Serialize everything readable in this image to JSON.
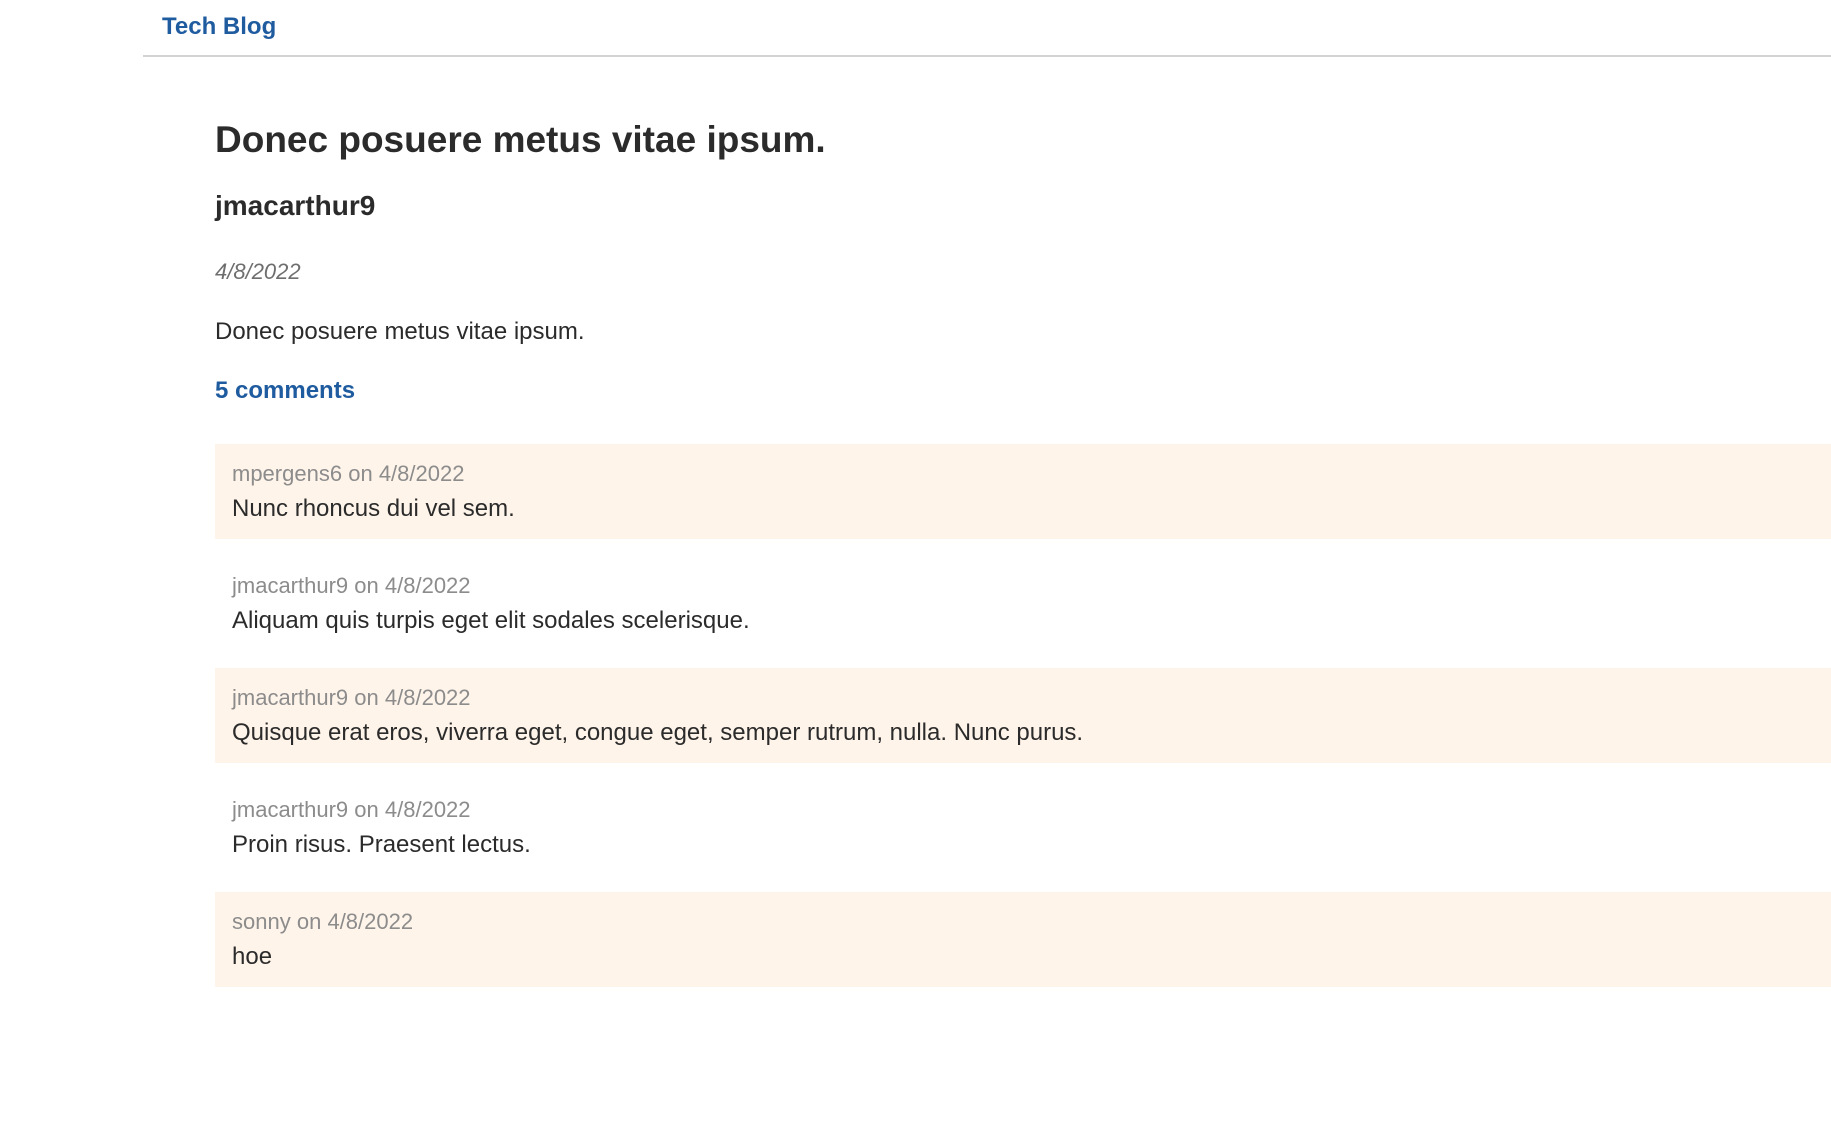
{
  "navbar": {
    "brand": "Tech Blog"
  },
  "post": {
    "title": "Donec posuere metus vitae ipsum.",
    "author": "jmacarthur9",
    "date": "4/8/2022",
    "body": "Donec posuere metus vitae ipsum.",
    "comment_count_label": "5 comments"
  },
  "comments": [
    {
      "author": "mpergens6",
      "on": "on",
      "date": "4/8/2022",
      "text": "Nunc rhoncus dui vel sem."
    },
    {
      "author": "jmacarthur9",
      "on": "on",
      "date": "4/8/2022",
      "text": "Aliquam quis turpis eget elit sodales scelerisque."
    },
    {
      "author": "jmacarthur9",
      "on": "on",
      "date": "4/8/2022",
      "text": "Quisque erat eros, viverra eget, congue eget, semper rutrum, nulla. Nunc purus."
    },
    {
      "author": "jmacarthur9",
      "on": "on",
      "date": "4/8/2022",
      "text": "Proin risus. Praesent lectus."
    },
    {
      "author": "sonny",
      "on": "on",
      "date": "4/8/2022",
      "text": "hoe"
    }
  ],
  "colors": {
    "accent": "#1f5b9f",
    "comment_shade": "#fff4ea",
    "meta_text": "#8c8c8c"
  }
}
